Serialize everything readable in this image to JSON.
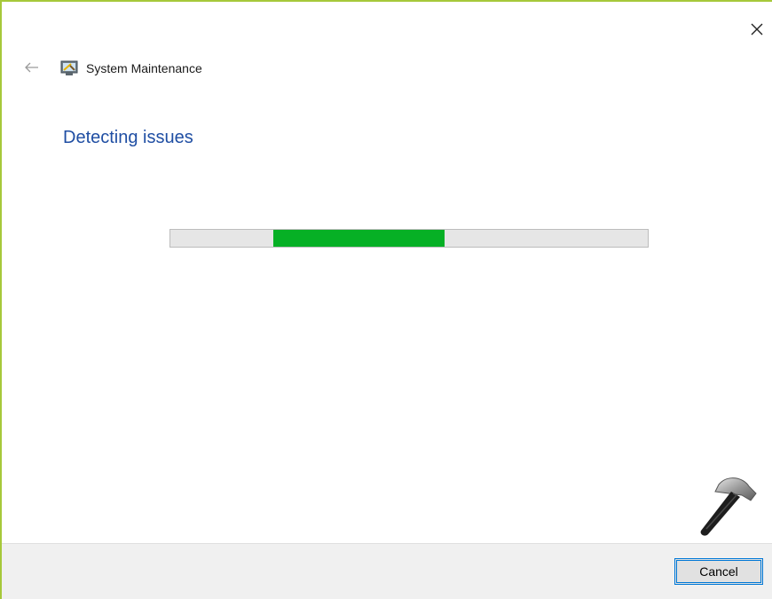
{
  "window": {
    "title": "System Maintenance",
    "close_icon": "close-icon",
    "back_icon": "back-arrow-icon",
    "app_icon": "system-maintenance-icon"
  },
  "main": {
    "heading": "Detecting issues",
    "progress": {
      "state": "indeterminate",
      "fill_start": 0.215,
      "fill_end": 0.575,
      "color": "#06b025"
    }
  },
  "footer": {
    "cancel_label": "Cancel"
  },
  "watermark": {
    "icon": "hammer-icon"
  },
  "colors": {
    "accent_border": "#a6c83a",
    "heading": "#1f4ea3",
    "button_focus": "#0078d7"
  }
}
